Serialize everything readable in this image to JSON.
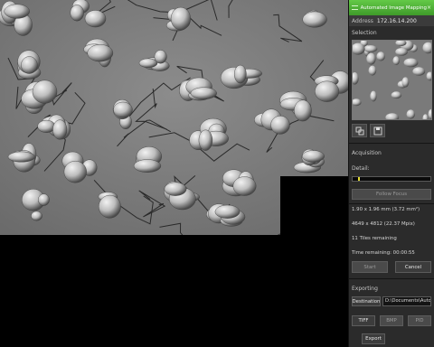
{
  "app": {
    "title": "Automated Image Mapping"
  },
  "address": {
    "label": "Address",
    "value": "172.16.14.200"
  },
  "selection": {
    "title": "Selection"
  },
  "acquisition": {
    "title": "Acquisition",
    "detail_label": "Detail:",
    "detail_level": 0.07,
    "follow_focus": "Follow Focus",
    "size": "1.90 x 1.96 mm (3.72 mm²)",
    "pixels": "4649 x 4812 (22.37 Mpix)",
    "tiles": "11 Tiles remaining",
    "time": "Time remaining: 00:00:55",
    "start": "Start",
    "cancel": "Cancel"
  },
  "exporting": {
    "title": "Exporting",
    "destination_label": "Destination",
    "destination_path": "D:\\Documents\\Autor",
    "formats": [
      "TIFF",
      "BMP",
      "PID"
    ],
    "export": "Export"
  },
  "colors": {
    "accent": "#4fb337",
    "panel": "#2b2b2b",
    "detail_marker": "#e7e033"
  },
  "icons": {
    "close": "close-icon",
    "grip": "grip-icon",
    "copy": "copy-icon",
    "save": "save-icon"
  }
}
